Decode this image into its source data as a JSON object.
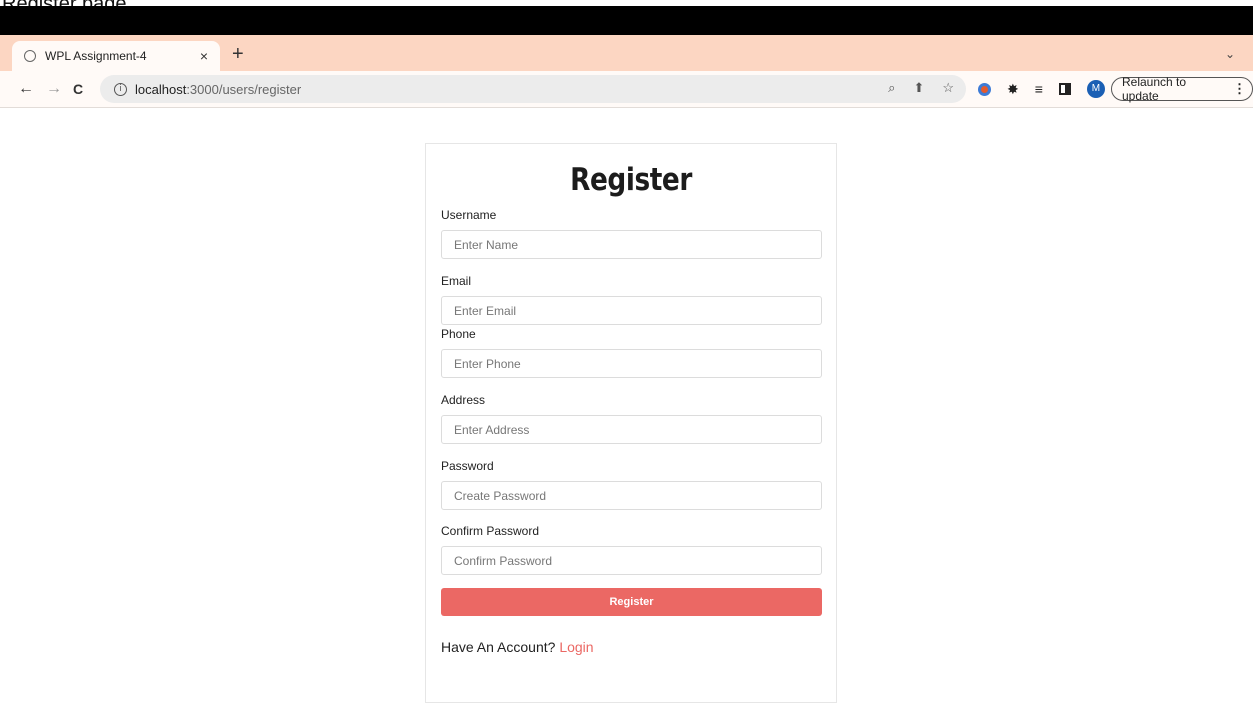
{
  "caption": "Register page",
  "browser": {
    "tab_title": "WPL Assignment-4",
    "tab_close": "×",
    "new_tab": "+",
    "tab_menu": "⌄",
    "url_host": "localhost",
    "url_path": ":3000/users/register",
    "relaunch_label": "Relaunch to update",
    "relaunch_menu": "⋮",
    "avatar_initial": "M",
    "back": "←",
    "forward": "→",
    "reload": "C",
    "info": "i"
  },
  "form": {
    "title": "Register",
    "fields": [
      {
        "label": "Username",
        "placeholder": "Enter Name"
      },
      {
        "label": "Email",
        "placeholder": "Enter Email"
      },
      {
        "label": "Phone",
        "placeholder": "Enter Phone"
      },
      {
        "label": "Address",
        "placeholder": "Enter Address"
      },
      {
        "label": "Password",
        "placeholder": "Create Password"
      },
      {
        "label": "Confirm Password",
        "placeholder": "Confirm Password"
      }
    ],
    "submit_label": "Register",
    "account_prompt": "Have An Account?",
    "login_link": "Login"
  },
  "colors": {
    "accent": "#eb6864",
    "tab_strip": "#fcd6c2"
  }
}
